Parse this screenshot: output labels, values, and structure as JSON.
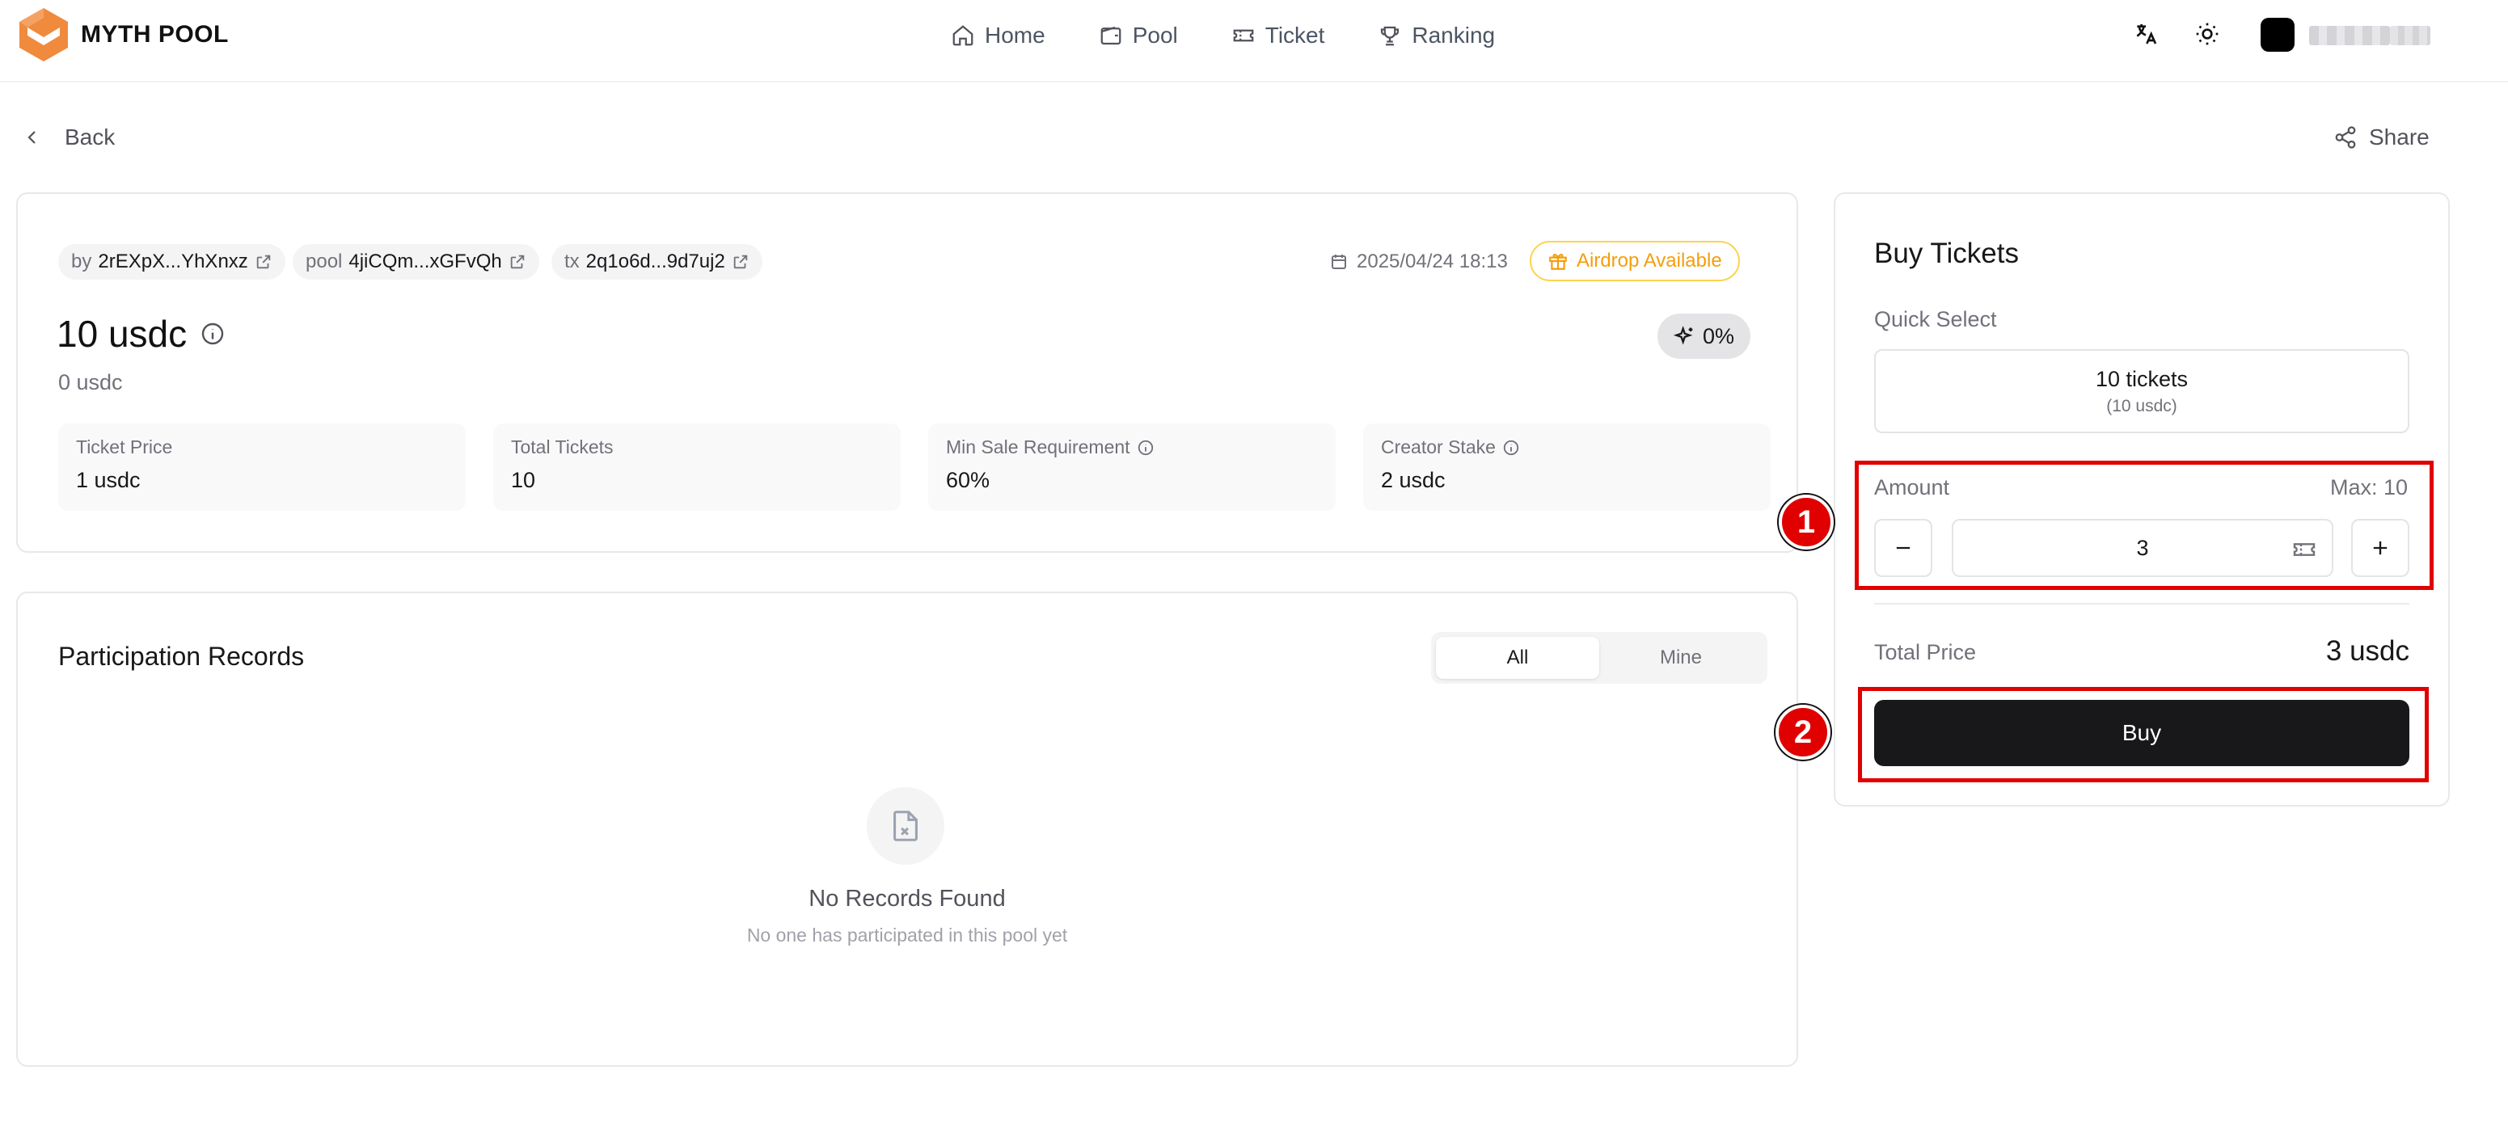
{
  "header": {
    "brand": "MYTH POOL",
    "nav": [
      {
        "label": "Home",
        "icon": "home-icon"
      },
      {
        "label": "Pool",
        "icon": "wallet-icon"
      },
      {
        "label": "Ticket",
        "icon": "ticket-icon"
      },
      {
        "label": "Ranking",
        "icon": "trophy-icon"
      }
    ]
  },
  "toolbar": {
    "back_label": "Back",
    "share_label": "Share"
  },
  "pool": {
    "chips": [
      {
        "label": "by",
        "value": "2rEXpX...YhXnxz"
      },
      {
        "label": "pool",
        "value": "4jiCQm...xGFvQh"
      },
      {
        "label": "tx",
        "value": "2q1o6d...9d7uj2"
      }
    ],
    "date": "2025/04/24 18:13",
    "airdrop": "Airdrop Available",
    "amount": "10 usdc",
    "amount_sub": "0 usdc",
    "progress": "0%",
    "stats": [
      {
        "label": "Ticket Price",
        "value": "1 usdc",
        "info": false
      },
      {
        "label": "Total Tickets",
        "value": "10",
        "info": false
      },
      {
        "label": "Min Sale Requirement",
        "value": "60%",
        "info": true
      },
      {
        "label": "Creator Stake",
        "value": "2 usdc",
        "info": true
      }
    ]
  },
  "records": {
    "title": "Participation Records",
    "tabs": [
      "All",
      "Mine"
    ],
    "empty_title": "No Records Found",
    "empty_sub": "No one has participated in this pool yet"
  },
  "buy": {
    "title": "Buy Tickets",
    "quick_select_label": "Quick Select",
    "quick_option_main": "10 tickets",
    "quick_option_sub": "(10 usdc)",
    "amount_label": "Amount",
    "max_label": "Max: 10",
    "quantity": "3",
    "total_price_label": "Total Price",
    "total_price": "3 usdc",
    "buy_label": "Buy"
  },
  "annotations": {
    "marker_1": "1",
    "marker_2": "2",
    "color": "#e00000"
  }
}
